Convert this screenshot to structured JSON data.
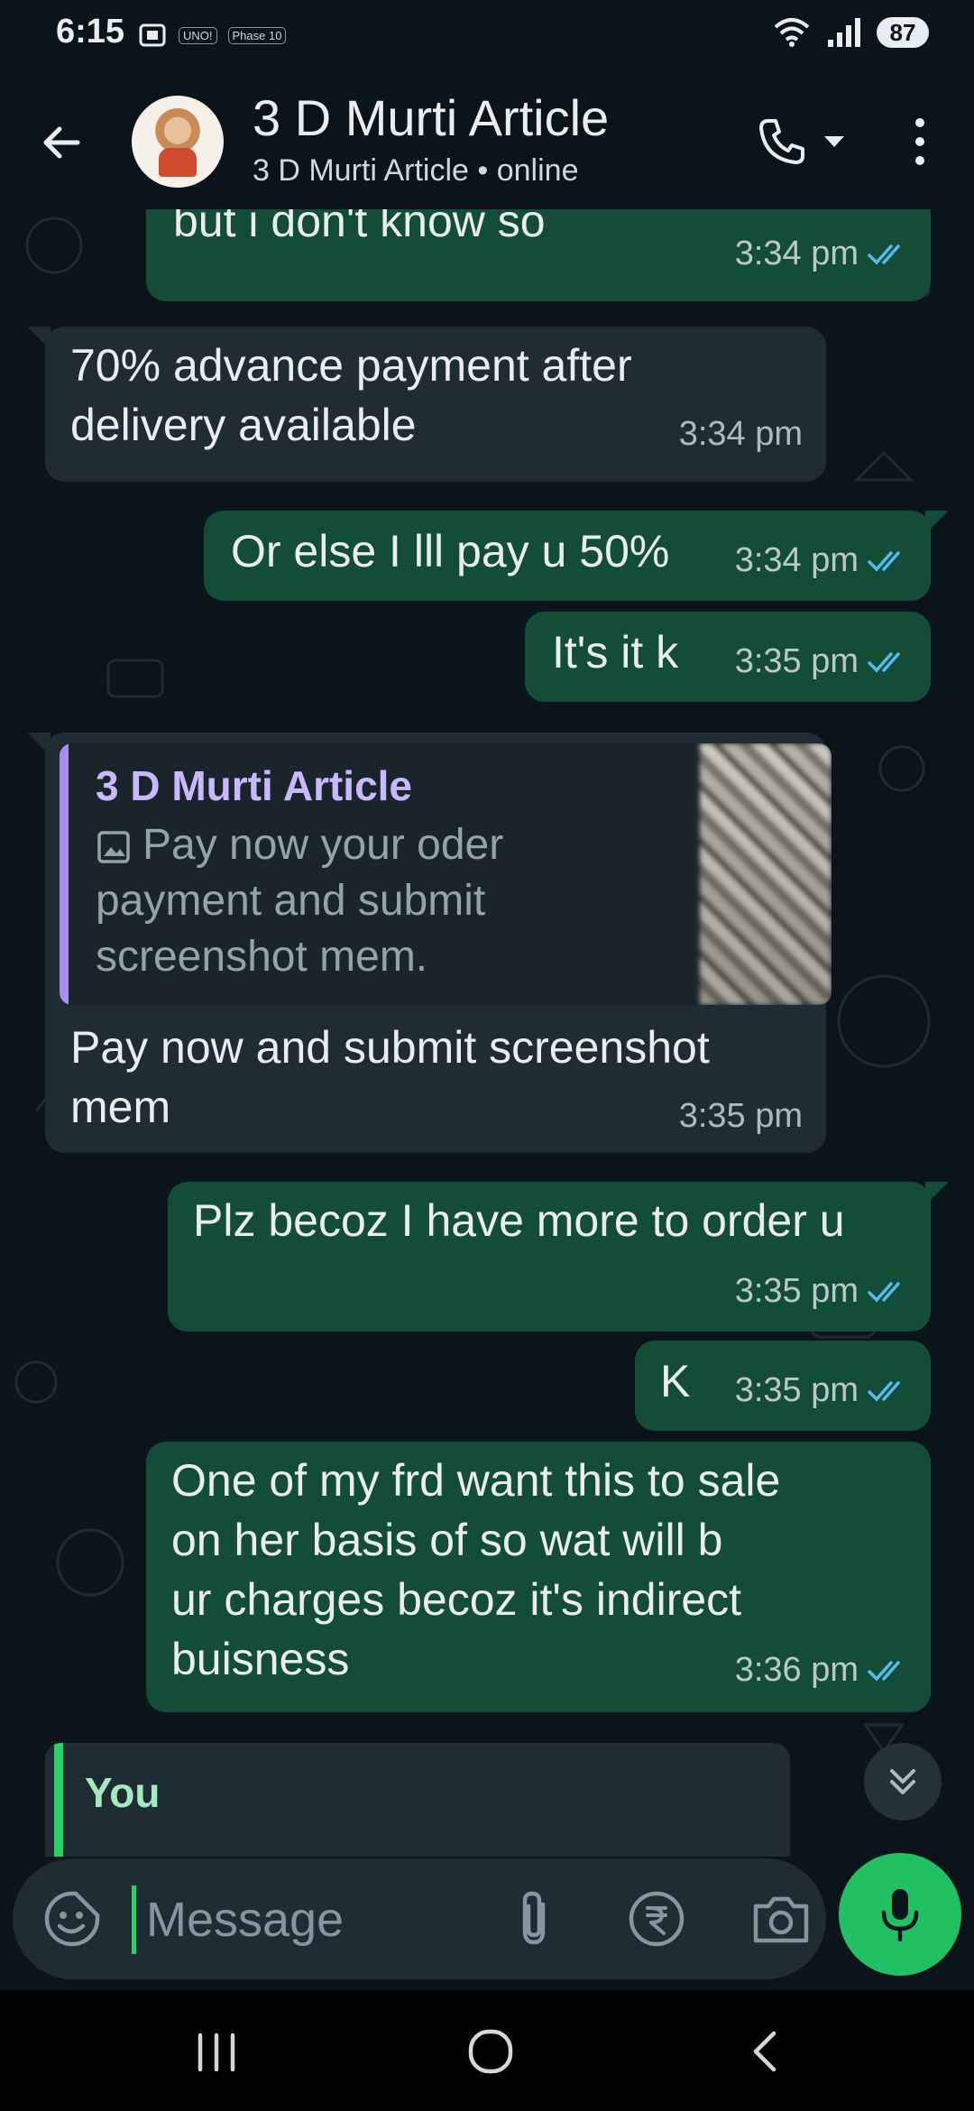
{
  "status_bar": {
    "time": "6:15",
    "badges": [
      "UNO!",
      "Phase 10"
    ],
    "battery": "87"
  },
  "header": {
    "title": "3 D Murti Article",
    "subtitle": "3 D Murti Article • online"
  },
  "messages": [
    {
      "direction": "out",
      "text": "but i don't know so",
      "time": "3:34 pm",
      "status": "read"
    },
    {
      "direction": "in",
      "lines": [
        "70% advance payment after",
        "delivery available"
      ],
      "time": "3:34 pm"
    },
    {
      "direction": "out",
      "text": "Or else I lll pay u 50%",
      "time": "3:34 pm",
      "status": "read"
    },
    {
      "direction": "out",
      "text": "It's it k",
      "time": "3:35 pm",
      "status": "read"
    },
    {
      "direction": "in",
      "quote": {
        "author": "3 D Murti Article",
        "lines": [
          "Pay now your oder",
          "payment and submit",
          "screenshot mem."
        ],
        "icon": "image-icon"
      },
      "lines": [
        "Pay now and submit screenshot",
        "mem"
      ],
      "time": "3:35 pm"
    },
    {
      "direction": "out",
      "text": "Plz becoz I have more to order u",
      "time": "3:35 pm",
      "status": "read"
    },
    {
      "direction": "out",
      "text": "K",
      "time": "3:35 pm",
      "status": "read"
    },
    {
      "direction": "out",
      "lines": [
        "One of my frd want this to sale",
        "on her basis of so wat will b",
        "ur charges becoz it's indirect",
        "buisness"
      ],
      "time": "3:36 pm",
      "status": "read"
    }
  ],
  "partial_reply": {
    "author": "You"
  },
  "composer": {
    "placeholder": "Message"
  },
  "colors": {
    "background": "#0b141a",
    "outgoing_bubble": "#144d37",
    "incoming_bubble": "#202c33",
    "accent_green": "#21c063",
    "read_ticks": "#53bdeb"
  }
}
